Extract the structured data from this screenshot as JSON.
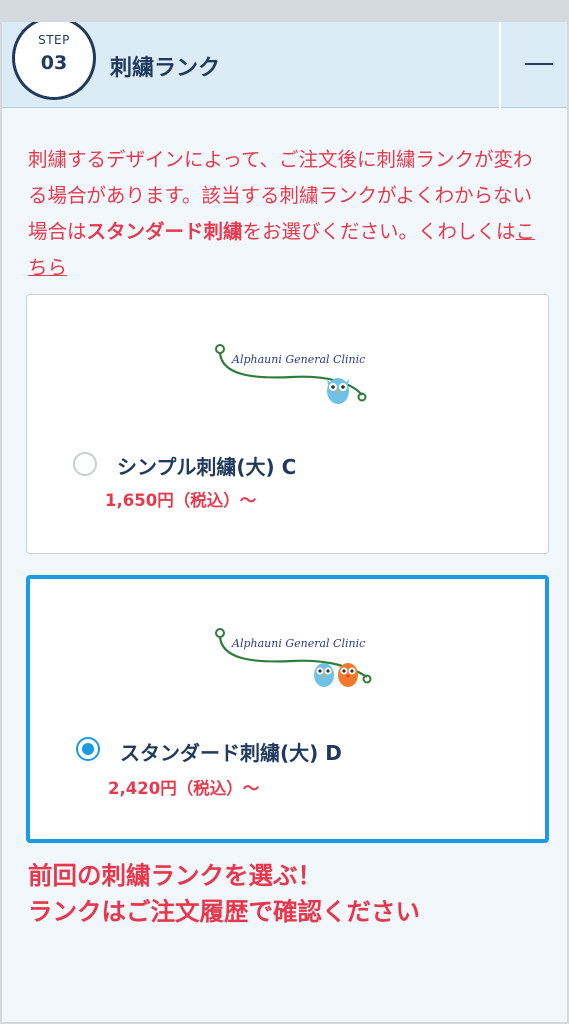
{
  "header": {
    "step_label": "STEP",
    "step_number": "03",
    "title": "刺繍ランク"
  },
  "notice": {
    "text_before": "刺繍するデザインによって、ご注文後に刺繍ランクが変わる場合があります。該当する刺繍ランクがよくわからない場合は",
    "emphasis": "スタンダード刺繍",
    "text_after": "をお選びください。くわしくは",
    "link": "こちら"
  },
  "logo_text": "Alphauni General Clinic",
  "options": [
    {
      "name": "シンプル刺繍(大) C",
      "price": "1,650円（税込）〜",
      "selected": false
    },
    {
      "name": "スタンダード刺繍(大) D",
      "price": "2,420円（税込）〜",
      "selected": true
    }
  ],
  "callout": {
    "line1": "前回の刺繍ランクを選ぶ！",
    "line2": "ランクはご注文履歴で確認ください"
  },
  "colors": {
    "accent": "#1b9be0",
    "navy": "#1f3a5c",
    "alert": "#e63a4e",
    "header_bg": "#dcecf6",
    "logo_green": "#2e7d3a",
    "logo_text": "#2b3a8c"
  }
}
